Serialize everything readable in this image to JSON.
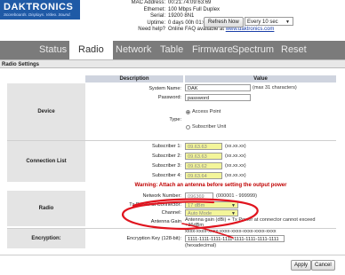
{
  "header": {
    "logo": "DAKTRONICS",
    "tagline": "Scoreboards. Displays. Video. Sound.",
    "info": [
      {
        "label": "MAC Address:",
        "value": "00:21:74:09:63:69"
      },
      {
        "label": "Ethernet:",
        "value": "100 Mbps Full Duplex"
      },
      {
        "label": "Serial:",
        "value": "19200 8N1"
      },
      {
        "label": "Uptime:",
        "value": "0 days 00h 01:01"
      }
    ],
    "help_label": "Need help?",
    "help_text": "Online FAQ available at",
    "help_link": "www.daktronics.com",
    "refresh_button": "Refresh Now",
    "refresh_interval": "Every 10 sec"
  },
  "nav": {
    "tabs": [
      "Status",
      "Radio",
      "Network",
      "Table",
      "Firmware",
      "Spectrum",
      "Reset"
    ],
    "active": "Radio"
  },
  "settings_title": "Radio Settings",
  "table": {
    "col_description": "Description",
    "col_value": "Value",
    "device": {
      "section": "Device",
      "system_name_label": "System Name:",
      "system_name_value": "DAK",
      "system_name_hint": "(max 31 characters)",
      "password_label": "Password:",
      "password_value": "password",
      "type_label": "Type:",
      "type_options": [
        "Access Point",
        "Subscriber Unit"
      ]
    },
    "connection": {
      "section": "Connection List",
      "subscribers": [
        {
          "label": "Subscriber 1:",
          "value": "09.63.63",
          "hint": "(xx.xx.xx)"
        },
        {
          "label": "Subscriber 2:",
          "value": "09.63.63",
          "hint": "(xx.xx.xx)"
        },
        {
          "label": "Subscriber 3:",
          "value": "09.63.62",
          "hint": "(xx.xx.xx)"
        },
        {
          "label": "Subscriber 4:",
          "value": "09.63.64",
          "hint": "(xx.xx.xx)"
        }
      ]
    },
    "warning": "Warning: Attach an antenna before setting the output power",
    "radio": {
      "section": "Radio",
      "network_number_label": "Network Number:",
      "network_number_value": "096369",
      "network_number_hint": "(000001 - 999999)",
      "tx_power_label": "Tx Power at Connector:",
      "tx_power_value": "17 dBm",
      "channel_label": "Channel:",
      "channel_value": "Auto Mode",
      "antenna_gain_label": "Antenna Gain",
      "antenna_gain_text": "Antenna gain (dBi) + Tx Power at connector cannot exceed +36dBm"
    },
    "encryption": {
      "section": "Encryption:",
      "key_label": "Encryption Key (128-bit):",
      "key_format": "xxxx-xxxx-xxxx-xxxx-xxxx-xxxx-xxxx-xxxx",
      "key_value": "1111-1111-1111-1111-1111-1111-1111-1111",
      "key_hint": "(hexadecimal)"
    }
  },
  "buttons": {
    "apply": "Apply",
    "cancel": "Cancel"
  },
  "colors": {
    "brand": "#1f5aa6",
    "nav": "#7b7b7b",
    "warning": "#c00000",
    "highlight": "#f3f59a",
    "annotation": "#e0141e"
  }
}
